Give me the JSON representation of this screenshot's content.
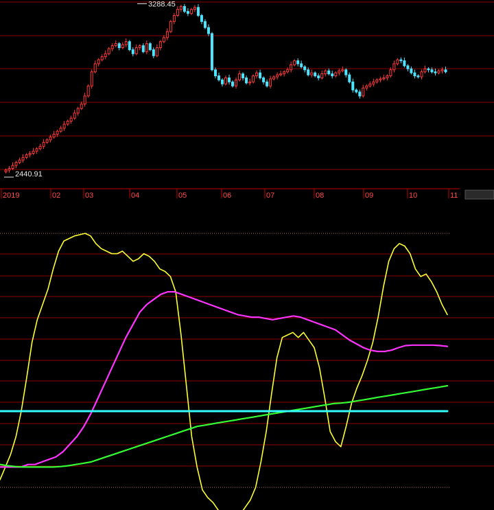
{
  "chart_data": [
    {
      "type": "candlestick",
      "title": "",
      "xlabel": "",
      "ylabel": "",
      "x_ticks": [
        "2019",
        "02",
        "03",
        "04",
        "05",
        "06",
        "07",
        "08",
        "09",
        "10",
        "11"
      ],
      "ylim": [
        2400,
        3300
      ],
      "annotations": {
        "high": "3288.45",
        "low": "2440.91"
      },
      "colors": {
        "up": "#ff3b3b",
        "down": "#4fe3ff",
        "grid": "#8b0000",
        "axis": "#c00000"
      },
      "close": [
        2462,
        2470,
        2485,
        2500,
        2512,
        2525,
        2538,
        2545,
        2556,
        2568,
        2580,
        2600,
        2612,
        2626,
        2640,
        2655,
        2670,
        2690,
        2705,
        2720,
        2745,
        2768,
        2790,
        2830,
        2880,
        2950,
        2990,
        3010,
        3025,
        3040,
        3065,
        3080,
        3090,
        3070,
        3085,
        3100,
        3060,
        3040,
        3070,
        3080,
        3050,
        3090,
        3060,
        3030,
        3070,
        3100,
        3120,
        3150,
        3200,
        3230,
        3260,
        3275,
        3250,
        3240,
        3260,
        3270,
        3230,
        3200,
        3170,
        3140,
        2960,
        2930,
        2910,
        2890,
        2920,
        2900,
        2880,
        2910,
        2940,
        2920,
        2895,
        2900,
        2930,
        2945,
        2920,
        2900,
        2880,
        2915,
        2925,
        2935,
        2940,
        2950,
        2960,
        2985,
        3005,
        2990,
        2975,
        2960,
        2935,
        2945,
        2930,
        2920,
        2940,
        2955,
        2940,
        2930,
        2945,
        2955,
        2960,
        2935,
        2900,
        2860,
        2850,
        2830,
        2870,
        2880,
        2890,
        2900,
        2910,
        2915,
        2920,
        2930,
        2960,
        2990,
        3010,
        3005,
        2980,
        2965,
        2945,
        2930,
        2925,
        2950,
        2965,
        2960,
        2950,
        2945,
        2955,
        2960,
        2950
      ]
    },
    {
      "type": "line",
      "title": "",
      "xlabel": "",
      "ylabel": "",
      "ylim": [
        0,
        100
      ],
      "series": [
        {
          "color": "#ffff33",
          "values": [
            3,
            8,
            13,
            20,
            30,
            43,
            57,
            66,
            72,
            78,
            86,
            93,
            97,
            98,
            99,
            99.5,
            100,
            99,
            96,
            94,
            93,
            92,
            92,
            93,
            91,
            89,
            90,
            92,
            91,
            89,
            86,
            85,
            83,
            77,
            60,
            40,
            20,
            8,
            -1,
            -4,
            -6,
            -9,
            -10,
            -12,
            -12,
            -11,
            -8,
            -5,
            0,
            10,
            22,
            37,
            51,
            59,
            60,
            61,
            59,
            61,
            58,
            55,
            47,
            35,
            22,
            18,
            16,
            24,
            33,
            39,
            44,
            50,
            57,
            67,
            79,
            89,
            94,
            96,
            95,
            92,
            86,
            83,
            84,
            81,
            77,
            72,
            68
          ]
        },
        {
          "color": "#ff33ff",
          "values": [
            8,
            8,
            8,
            8,
            9,
            9,
            10,
            11,
            12,
            14,
            17,
            20,
            24,
            29,
            35,
            41,
            47,
            53,
            59,
            64,
            69,
            72,
            74,
            76,
            77,
            77,
            76,
            75,
            74,
            73,
            72,
            71,
            70,
            69,
            68,
            67.5,
            67,
            67,
            66.5,
            66,
            66.5,
            67,
            67.5,
            67,
            66,
            65,
            64,
            63,
            62,
            60,
            58,
            56.5,
            55,
            54,
            53.5,
            53.5,
            54,
            55,
            55.8,
            56,
            56,
            56,
            56,
            55.8,
            55.5
          ]
        },
        {
          "color": "#33ff33",
          "values": [
            9,
            8.5,
            8.2,
            8,
            8,
            8,
            8,
            8,
            8.2,
            8.5,
            9,
            9.5,
            10,
            11,
            12,
            13,
            14,
            15,
            16,
            17,
            18,
            19,
            20,
            21,
            22,
            23,
            24,
            24.5,
            25,
            25.5,
            26,
            26.5,
            27,
            27.5,
            28,
            28.5,
            29,
            29.5,
            30,
            30.5,
            31,
            31.5,
            32,
            32.5,
            33,
            33.2,
            33.5,
            34,
            34.5,
            35,
            35.5,
            36,
            36.5,
            37,
            37.5,
            38,
            38.5,
            39,
            39.5,
            40
          ]
        },
        {
          "color": "#33ffff",
          "values": [
            30,
            30,
            30,
            30,
            30,
            30,
            30,
            30,
            30,
            30,
            30,
            30,
            30,
            30,
            30,
            30,
            30,
            30,
            30,
            30,
            30,
            30,
            30,
            30,
            30,
            30,
            30,
            30,
            30,
            30
          ]
        }
      ]
    }
  ]
}
